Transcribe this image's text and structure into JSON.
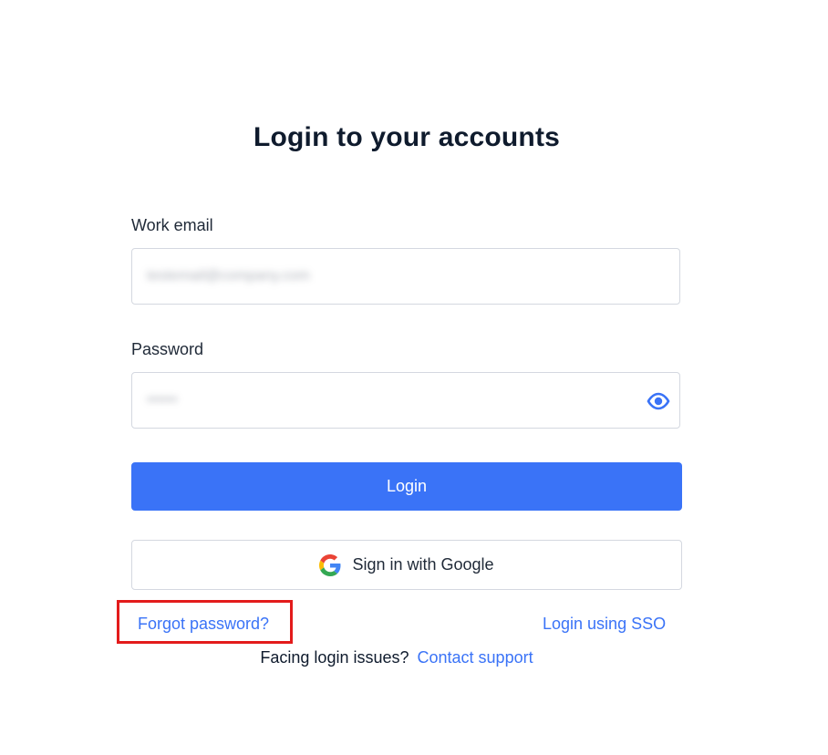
{
  "page": {
    "title": "Login to your accounts"
  },
  "form": {
    "email_label": "Work email",
    "email_value": "testemail@company.com",
    "password_label": "Password",
    "password_value": "••••••",
    "login_label": "Login",
    "google_label": "Sign in with Google"
  },
  "links": {
    "forgot_password": "Forgot password?",
    "sso": "Login using SSO",
    "issues_text": "Facing login issues?",
    "contact_support": "Contact support"
  },
  "colors": {
    "accent": "#3a73f7",
    "highlight_box": "#e31b1b",
    "title": "#0f1b2d"
  },
  "icons": {
    "password_toggle": "eye-icon",
    "google": "google-icon"
  }
}
